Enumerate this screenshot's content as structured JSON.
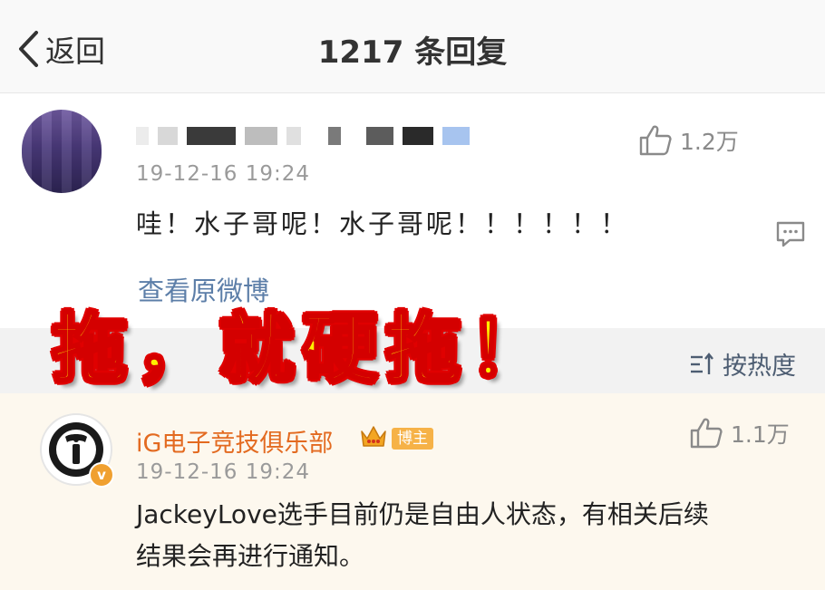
{
  "nav": {
    "back_label": "返回",
    "title": "1217 条回复"
  },
  "comment": {
    "time": "19-12-16 19:24",
    "likes": "1.2万",
    "text": "哇！水子哥呢！水子哥呢！！！！！！",
    "view_original": "查看原微博"
  },
  "sort": {
    "label": "按热度"
  },
  "author_reply": {
    "name": "iG电子竞技俱乐部",
    "badge": "博主",
    "time": "19-12-16 19:24",
    "likes": "1.1万",
    "text_line1": "JackeyLove选手目前仍是自由人状态，有相关后续",
    "text_line2": "结果会再进行通知。"
  },
  "overlay": {
    "caption": "拖，就硬拖！"
  },
  "colors": {
    "link": "#5c7ea8",
    "author_name": "#e36a20",
    "badge": "#f6b247",
    "overlay_fill": "#ffee00",
    "overlay_stroke": "#e00000"
  },
  "icons": [
    "chevron-left-icon",
    "thumbs-up-icon",
    "comment-reply-icon",
    "sort-icon",
    "crown-icon",
    "verified-icon"
  ]
}
